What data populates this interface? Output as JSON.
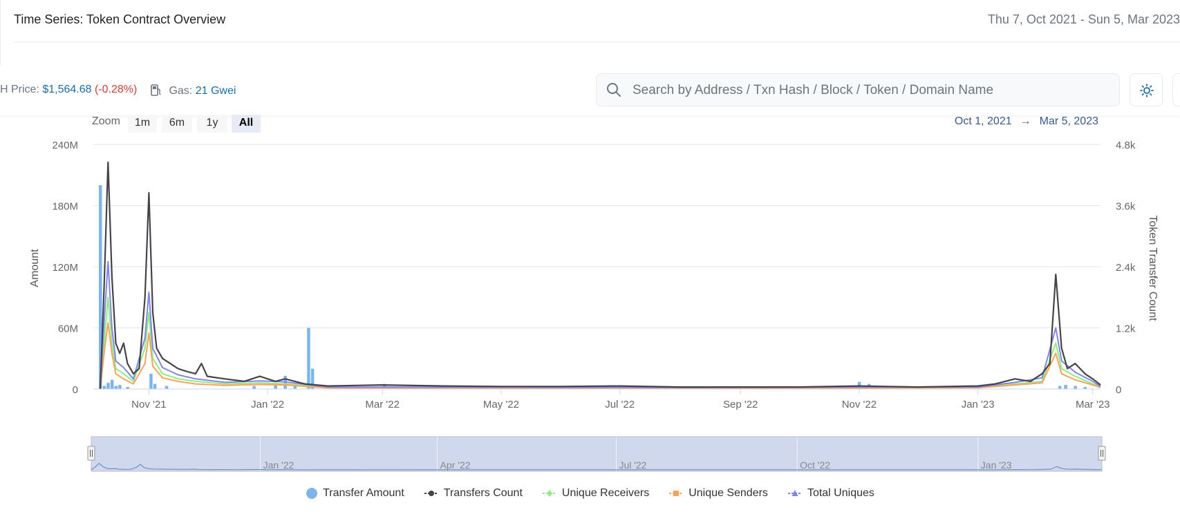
{
  "header": {
    "title": "Time Series: Token Contract Overview",
    "date_range": "Thu 7, Oct 2021 - Sun 5, Mar 2023"
  },
  "topbar": {
    "price_label": "H Price:",
    "price_value": "$1,564.68",
    "price_change": "(-0.28%)",
    "gas_label": "Gas:",
    "gas_value": "21 Gwei",
    "search_placeholder": "Search by Address / Txn Hash / Block / Token / Domain Name",
    "icons": [
      "gas-pump-icon",
      "search-icon",
      "sun-icon"
    ],
    "colors": {
      "link": "#1a6aa5",
      "negative": "#d23a3a"
    }
  },
  "zoom": {
    "label": "Zoom",
    "buttons": [
      "1m",
      "6m",
      "1y",
      "All"
    ],
    "selected": "All",
    "from": "Oct 1, 2021",
    "arrow": "→",
    "to": "Mar 5, 2023"
  },
  "navigator": {
    "labels": [
      "Jan '22",
      "Apr '22",
      "Jul '22",
      "Oct '22",
      "Jan '23"
    ]
  },
  "chart_data": {
    "type": "line",
    "title": "",
    "x_range": [
      "2021-10-07",
      "2023-03-05"
    ],
    "xlabel": "",
    "x_tick_labels": [
      "Nov '21",
      "Jan '22",
      "Mar '22",
      "May '22",
      "Jul '22",
      "Sep '22",
      "Nov '22",
      "Jan '23",
      "Mar '23"
    ],
    "y_left": {
      "label": "Amount",
      "min": 0,
      "max": 240000000,
      "tick_labels": [
        "0",
        "60M",
        "120M",
        "180M",
        "240M"
      ]
    },
    "y_right": {
      "label": "Token Transfer Count",
      "min": 0,
      "max": 4800,
      "tick_labels": [
        "0",
        "1.2k",
        "2.4k",
        "3.6k",
        "4.8k"
      ]
    },
    "grid": true,
    "legend_position": "bottom",
    "colors": {
      "transfer_amount": "#7cb5ec",
      "transfers_count": "#434348",
      "unique_receivers": "#90ed7d",
      "unique_senders": "#f7a35c",
      "total_uniques": "#8085e9"
    },
    "series": [
      {
        "name": "Transfer Amount",
        "type": "column",
        "axis": "left",
        "marker": "circle",
        "points": [
          [
            "2021-10-07",
            200000000
          ],
          [
            "2021-10-09",
            3000000
          ],
          [
            "2021-10-11",
            6000000
          ],
          [
            "2021-10-13",
            9000000
          ],
          [
            "2021-10-15",
            3000000
          ],
          [
            "2021-10-17",
            4000000
          ],
          [
            "2021-10-21",
            2000000
          ],
          [
            "2021-11-02",
            15000000
          ],
          [
            "2021-11-04",
            5000000
          ],
          [
            "2021-11-10",
            3000000
          ],
          [
            "2021-12-25",
            3000000
          ],
          [
            "2022-01-05",
            4000000
          ],
          [
            "2022-01-10",
            13000000
          ],
          [
            "2022-01-15",
            3000000
          ],
          [
            "2022-01-22",
            60000000
          ],
          [
            "2022-01-24",
            20000000
          ],
          [
            "2022-03-02",
            5000000
          ],
          [
            "2022-03-10",
            2000000
          ],
          [
            "2022-04-15",
            2000000
          ],
          [
            "2022-06-25",
            2000000
          ],
          [
            "2022-07-02",
            2000000
          ],
          [
            "2022-11-01",
            7000000
          ],
          [
            "2022-11-06",
            5000000
          ],
          [
            "2023-02-12",
            3000000
          ],
          [
            "2023-02-15",
            4000000
          ],
          [
            "2023-02-20",
            3000000
          ],
          [
            "2023-02-25",
            2000000
          ]
        ]
      },
      {
        "name": "Transfers Count",
        "type": "line",
        "axis": "right",
        "marker": "circle",
        "points": [
          [
            "2021-10-07",
            0
          ],
          [
            "2021-10-09",
            2000
          ],
          [
            "2021-10-11",
            4450
          ],
          [
            "2021-10-13",
            2200
          ],
          [
            "2021-10-15",
            900
          ],
          [
            "2021-10-17",
            700
          ],
          [
            "2021-10-19",
            900
          ],
          [
            "2021-10-21",
            500
          ],
          [
            "2021-10-24",
            300
          ],
          [
            "2021-10-27",
            400
          ],
          [
            "2021-10-30",
            1800
          ],
          [
            "2021-11-01",
            3850
          ],
          [
            "2021-11-03",
            1500
          ],
          [
            "2021-11-05",
            800
          ],
          [
            "2021-11-08",
            600
          ],
          [
            "2021-11-12",
            500
          ],
          [
            "2021-11-16",
            400
          ],
          [
            "2021-11-20",
            350
          ],
          [
            "2021-11-25",
            300
          ],
          [
            "2021-11-28",
            500
          ],
          [
            "2021-12-01",
            250
          ],
          [
            "2021-12-10",
            200
          ],
          [
            "2021-12-20",
            150
          ],
          [
            "2021-12-28",
            250
          ],
          [
            "2022-01-05",
            150
          ],
          [
            "2022-01-10",
            200
          ],
          [
            "2022-01-20",
            100
          ],
          [
            "2022-02-01",
            60
          ],
          [
            "2022-03-01",
            80
          ],
          [
            "2022-04-01",
            60
          ],
          [
            "2022-05-01",
            50
          ],
          [
            "2022-06-01",
            50
          ],
          [
            "2022-07-01",
            60
          ],
          [
            "2022-08-01",
            40
          ],
          [
            "2022-09-01",
            40
          ],
          [
            "2022-10-01",
            40
          ],
          [
            "2022-11-01",
            60
          ],
          [
            "2022-12-01",
            40
          ],
          [
            "2023-01-01",
            60
          ],
          [
            "2023-01-10",
            100
          ],
          [
            "2023-01-20",
            200
          ],
          [
            "2023-01-28",
            150
          ],
          [
            "2023-02-03",
            300
          ],
          [
            "2023-02-07",
            500
          ],
          [
            "2023-02-10",
            2250
          ],
          [
            "2023-02-13",
            800
          ],
          [
            "2023-02-16",
            400
          ],
          [
            "2023-02-20",
            500
          ],
          [
            "2023-02-25",
            300
          ],
          [
            "2023-03-01",
            200
          ],
          [
            "2023-03-05",
            80
          ]
        ]
      },
      {
        "name": "Unique Receivers",
        "type": "line",
        "axis": "right",
        "marker": "diamond",
        "points": [
          [
            "2021-10-07",
            0
          ],
          [
            "2021-10-09",
            900
          ],
          [
            "2021-10-11",
            1800
          ],
          [
            "2021-10-13",
            900
          ],
          [
            "2021-10-15",
            400
          ],
          [
            "2021-10-19",
            300
          ],
          [
            "2021-10-24",
            150
          ],
          [
            "2021-10-30",
            800
          ],
          [
            "2021-11-01",
            1500
          ],
          [
            "2021-11-03",
            600
          ],
          [
            "2021-11-08",
            300
          ],
          [
            "2021-11-16",
            200
          ],
          [
            "2021-11-25",
            150
          ],
          [
            "2021-12-10",
            100
          ],
          [
            "2021-12-28",
            120
          ],
          [
            "2022-01-10",
            100
          ],
          [
            "2022-02-01",
            30
          ],
          [
            "2022-05-01",
            25
          ],
          [
            "2022-08-01",
            20
          ],
          [
            "2022-11-01",
            30
          ],
          [
            "2023-01-01",
            30
          ],
          [
            "2023-01-20",
            100
          ],
          [
            "2023-02-03",
            150
          ],
          [
            "2023-02-10",
            900
          ],
          [
            "2023-02-13",
            400
          ],
          [
            "2023-02-20",
            250
          ],
          [
            "2023-03-01",
            100
          ],
          [
            "2023-03-05",
            40
          ]
        ]
      },
      {
        "name": "Unique Senders",
        "type": "line",
        "axis": "right",
        "marker": "square",
        "points": [
          [
            "2021-10-07",
            0
          ],
          [
            "2021-10-09",
            700
          ],
          [
            "2021-10-11",
            1300
          ],
          [
            "2021-10-13",
            700
          ],
          [
            "2021-10-15",
            300
          ],
          [
            "2021-10-19",
            200
          ],
          [
            "2021-10-24",
            100
          ],
          [
            "2021-10-30",
            500
          ],
          [
            "2021-11-01",
            1100
          ],
          [
            "2021-11-03",
            450
          ],
          [
            "2021-11-08",
            220
          ],
          [
            "2021-11-16",
            150
          ],
          [
            "2021-11-25",
            100
          ],
          [
            "2021-12-10",
            70
          ],
          [
            "2021-12-28",
            90
          ],
          [
            "2022-01-10",
            80
          ],
          [
            "2022-02-01",
            20
          ],
          [
            "2022-05-01",
            20
          ],
          [
            "2022-08-01",
            15
          ],
          [
            "2022-11-01",
            20
          ],
          [
            "2023-01-01",
            25
          ],
          [
            "2023-01-20",
            80
          ],
          [
            "2023-02-03",
            120
          ],
          [
            "2023-02-10",
            700
          ],
          [
            "2023-02-13",
            300
          ],
          [
            "2023-02-20",
            180
          ],
          [
            "2023-03-01",
            80
          ],
          [
            "2023-03-05",
            30
          ]
        ]
      },
      {
        "name": "Total Uniques",
        "type": "line",
        "axis": "right",
        "marker": "triangle",
        "points": [
          [
            "2021-10-07",
            0
          ],
          [
            "2021-10-09",
            1300
          ],
          [
            "2021-10-11",
            2500
          ],
          [
            "2021-10-13",
            1200
          ],
          [
            "2021-10-15",
            550
          ],
          [
            "2021-10-19",
            420
          ],
          [
            "2021-10-24",
            200
          ],
          [
            "2021-10-30",
            1000
          ],
          [
            "2021-11-01",
            1900
          ],
          [
            "2021-11-03",
            800
          ],
          [
            "2021-11-08",
            420
          ],
          [
            "2021-11-16",
            280
          ],
          [
            "2021-11-25",
            200
          ],
          [
            "2021-12-10",
            130
          ],
          [
            "2021-12-28",
            160
          ],
          [
            "2022-01-10",
            140
          ],
          [
            "2022-02-01",
            40
          ],
          [
            "2022-05-01",
            35
          ],
          [
            "2022-08-01",
            30
          ],
          [
            "2022-11-01",
            40
          ],
          [
            "2023-01-01",
            40
          ],
          [
            "2023-01-20",
            130
          ],
          [
            "2023-02-03",
            220
          ],
          [
            "2023-02-10",
            1200
          ],
          [
            "2023-02-13",
            550
          ],
          [
            "2023-02-20",
            330
          ],
          [
            "2023-03-01",
            150
          ],
          [
            "2023-03-05",
            50
          ]
        ]
      }
    ]
  }
}
